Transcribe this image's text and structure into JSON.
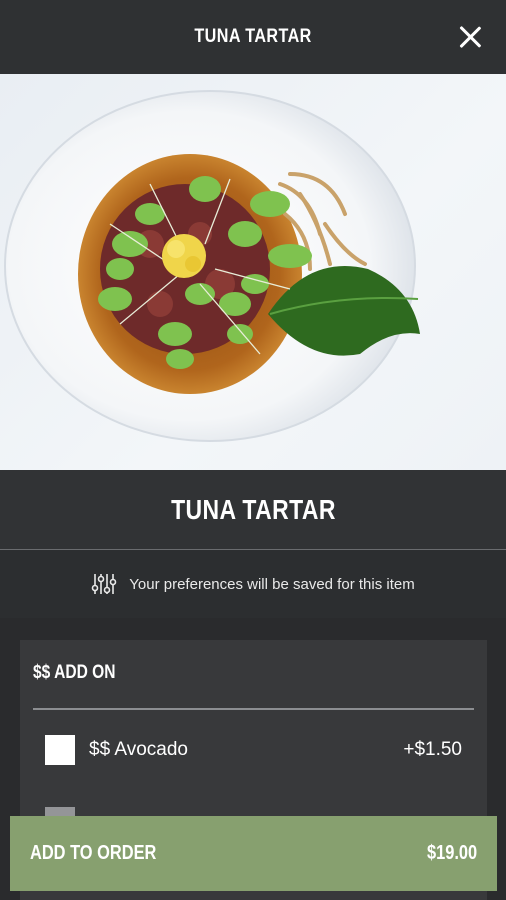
{
  "header": {
    "title": "TUNA TARTAR"
  },
  "item": {
    "name": "TUNA TARTAR"
  },
  "preferences": {
    "text": "Your preferences will be saved for this item"
  },
  "addon_section": {
    "heading": "$$ ADD ON",
    "options": [
      {
        "label": "$$ Avocado",
        "price": "+$1.50",
        "checked": false
      }
    ]
  },
  "cta": {
    "label": "ADD TO ORDER",
    "total": "$19.00"
  },
  "colors": {
    "accent": "#87a06f",
    "background": "#2a2b2d",
    "card": "#38393b"
  }
}
